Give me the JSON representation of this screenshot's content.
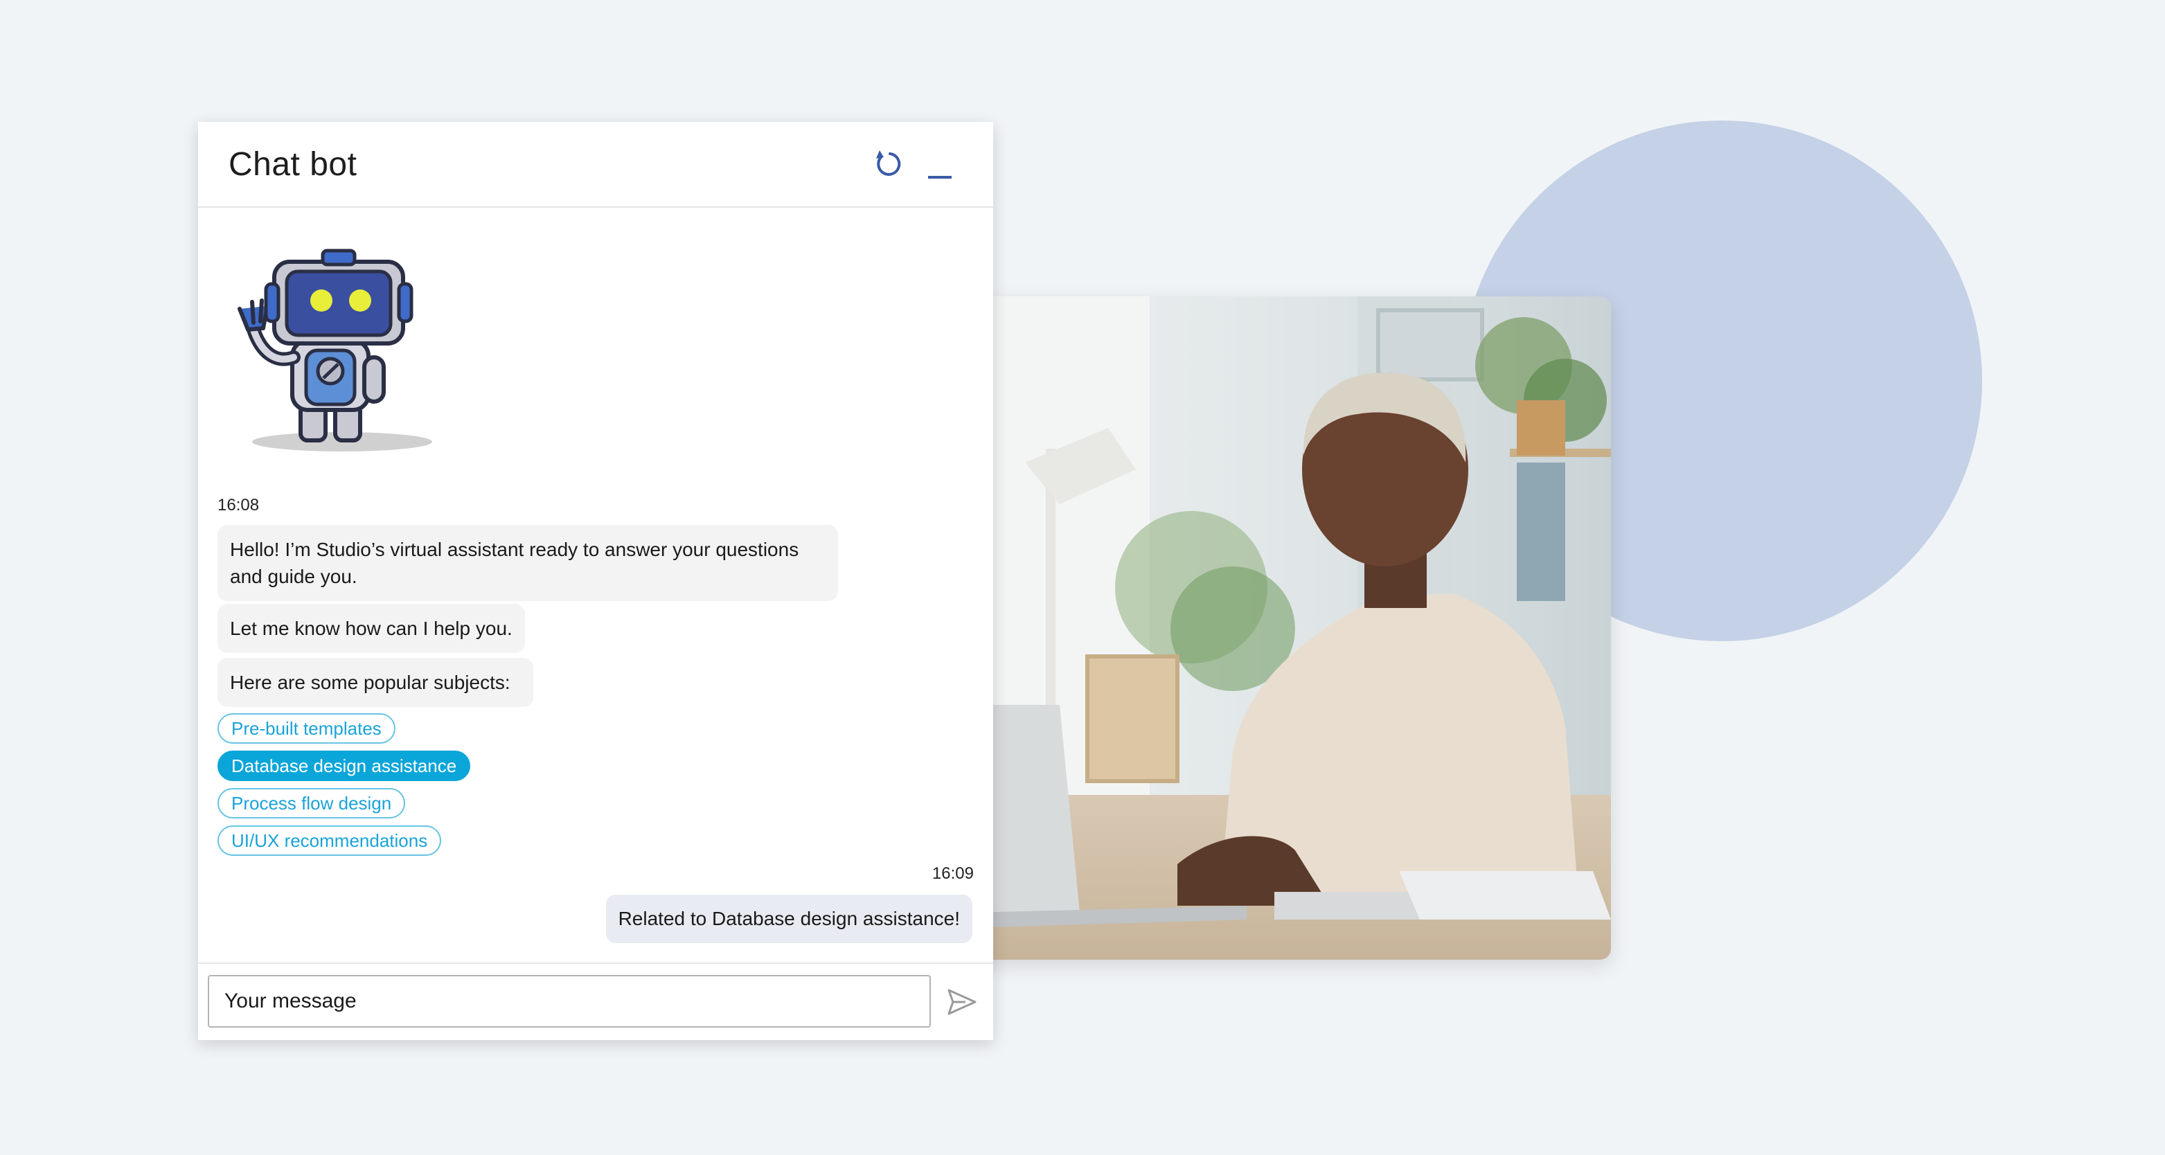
{
  "window": {
    "title": "Chat bot",
    "reset_icon": "reset-icon",
    "minimize_icon": "minimize-icon"
  },
  "conversation": {
    "bot_time": "16:08",
    "bot_messages": [
      "Hello! I’m Studio’s virtual assistant ready to answer your questions and guide you.",
      "Let me know how can I help you.",
      "Here are some popular subjects:"
    ],
    "suggestions": [
      {
        "label": "Pre-built templates",
        "selected": false
      },
      {
        "label": "Database design assistance",
        "selected": true
      },
      {
        "label": "Process flow design",
        "selected": false
      },
      {
        "label": "UI/UX recommendations",
        "selected": false
      }
    ],
    "user_time": "16:09",
    "user_message": "Related to Database design assistance!"
  },
  "composer": {
    "placeholder": "Your message",
    "send_icon": "send-icon"
  },
  "colors": {
    "accent": "#0aa5d9",
    "icon_blue": "#3a5aa6",
    "backdrop_circle": "#c4d1e6",
    "page_background": "#f1f4f7"
  }
}
